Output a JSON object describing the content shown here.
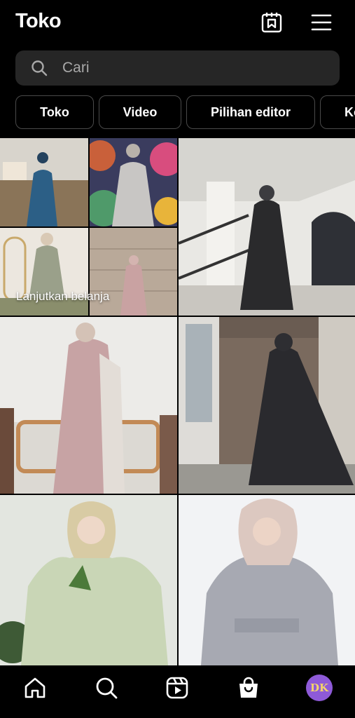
{
  "header": {
    "title": "Toko"
  },
  "search": {
    "placeholder": "Cari"
  },
  "chips": [
    "Toko",
    "Video",
    "Pilihan editor",
    "Ko"
  ],
  "grid": {
    "overlay_caption": "Lanjutkan belanja"
  },
  "avatar": {
    "initials": "DK"
  },
  "icons": {
    "saved": "saved-collection-icon",
    "menu": "hamburger-menu-icon",
    "search": "search-icon",
    "home": "home-icon",
    "explore": "search-icon",
    "reels": "reels-icon",
    "shop": "shopping-bag-icon"
  },
  "colors": {
    "background": "#000000",
    "search_bg": "#262626",
    "chip_border": "#4a4a4a",
    "avatar_bg": "#8e5ad8"
  }
}
